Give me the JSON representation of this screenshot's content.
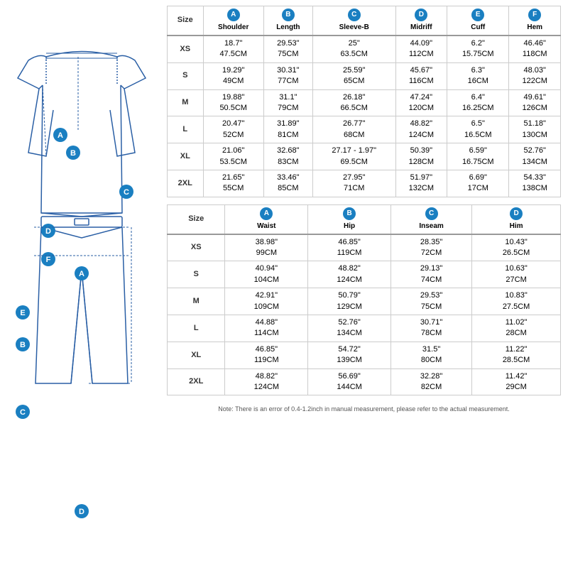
{
  "tables": {
    "top": {
      "columns": [
        {
          "letter": "A",
          "label": "Shoulder"
        },
        {
          "letter": "B",
          "label": "Length"
        },
        {
          "letter": "C",
          "label": "Sleeve-B"
        },
        {
          "letter": "D",
          "label": "Midriff"
        },
        {
          "letter": "E",
          "label": "Cuff"
        },
        {
          "letter": "F",
          "label": "Hem"
        }
      ],
      "rows": [
        {
          "size": "XS",
          "vals": [
            [
              "18.7\"",
              "47.5CM"
            ],
            [
              "29.53\"",
              "75CM"
            ],
            [
              "25\"",
              "63.5CM"
            ],
            [
              "44.09\"",
              "112CM"
            ],
            [
              "6.2\"",
              "15.75CM"
            ],
            [
              "46.46\"",
              "118CM"
            ]
          ]
        },
        {
          "size": "S",
          "vals": [
            [
              "19.29\"",
              "49CM"
            ],
            [
              "30.31\"",
              "77CM"
            ],
            [
              "25.59\"",
              "65CM"
            ],
            [
              "45.67\"",
              "116CM"
            ],
            [
              "6.3\"",
              "16CM"
            ],
            [
              "48.03\"",
              "122CM"
            ]
          ]
        },
        {
          "size": "M",
          "vals": [
            [
              "19.88\"",
              "50.5CM"
            ],
            [
              "31.1\"",
              "79CM"
            ],
            [
              "26.18\"",
              "66.5CM"
            ],
            [
              "47.24\"",
              "120CM"
            ],
            [
              "6.4\"",
              "16.25CM"
            ],
            [
              "49.61\"",
              "126CM"
            ]
          ]
        },
        {
          "size": "L",
          "vals": [
            [
              "20.47\"",
              "52CM"
            ],
            [
              "31.89\"",
              "81CM"
            ],
            [
              "26.77\"",
              "68CM"
            ],
            [
              "48.82\"",
              "124CM"
            ],
            [
              "6.5\"",
              "16.5CM"
            ],
            [
              "51.18\"",
              "130CM"
            ]
          ]
        },
        {
          "size": "XL",
          "vals": [
            [
              "21.06\"",
              "53.5CM"
            ],
            [
              "32.68\"",
              "83CM"
            ],
            [
              "27.17 - 1.97\"",
              "69.5CM"
            ],
            [
              "50.39\"",
              "128CM"
            ],
            [
              "6.59\"",
              "16.75CM"
            ],
            [
              "52.76\"",
              "134CM"
            ]
          ]
        },
        {
          "size": "2XL",
          "vals": [
            [
              "21.65\"",
              "55CM"
            ],
            [
              "33.46\"",
              "85CM"
            ],
            [
              "27.95\"",
              "71CM"
            ],
            [
              "51.97\"",
              "132CM"
            ],
            [
              "6.69\"",
              "17CM"
            ],
            [
              "54.33\"",
              "138CM"
            ]
          ]
        }
      ]
    },
    "bottom": {
      "columns": [
        {
          "letter": "A",
          "label": "Waist"
        },
        {
          "letter": "B",
          "label": "Hip"
        },
        {
          "letter": "C",
          "label": "Inseam"
        },
        {
          "letter": "D",
          "label": "Him"
        }
      ],
      "rows": [
        {
          "size": "XS",
          "vals": [
            [
              "38.98\"",
              "99CM"
            ],
            [
              "46.85\"",
              "119CM"
            ],
            [
              "28.35\"",
              "72CM"
            ],
            [
              "10.43\"",
              "26.5CM"
            ]
          ]
        },
        {
          "size": "S",
          "vals": [
            [
              "40.94\"",
              "104CM"
            ],
            [
              "48.82\"",
              "124CM"
            ],
            [
              "29.13\"",
              "74CM"
            ],
            [
              "10.63\"",
              "27CM"
            ]
          ]
        },
        {
          "size": "M",
          "vals": [
            [
              "42.91\"",
              "109CM"
            ],
            [
              "50.79\"",
              "129CM"
            ],
            [
              "29.53\"",
              "75CM"
            ],
            [
              "10.83\"",
              "27.5CM"
            ]
          ]
        },
        {
          "size": "L",
          "vals": [
            [
              "44.88\"",
              "114CM"
            ],
            [
              "52.76\"",
              "134CM"
            ],
            [
              "30.71\"",
              "78CM"
            ],
            [
              "11.02\"",
              "28CM"
            ]
          ]
        },
        {
          "size": "XL",
          "vals": [
            [
              "46.85\"",
              "119CM"
            ],
            [
              "54.72\"",
              "139CM"
            ],
            [
              "31.5\"",
              "80CM"
            ],
            [
              "11.22\"",
              "28.5CM"
            ]
          ]
        },
        {
          "size": "2XL",
          "vals": [
            [
              "48.82\"",
              "124CM"
            ],
            [
              "56.69\"",
              "144CM"
            ],
            [
              "32.28\"",
              "82CM"
            ],
            [
              "11.42\"",
              "29CM"
            ]
          ]
        }
      ]
    }
  },
  "note": "Note: There is an error of 0.4-1.2inch in manual measurement, please refer to the actual measurement."
}
